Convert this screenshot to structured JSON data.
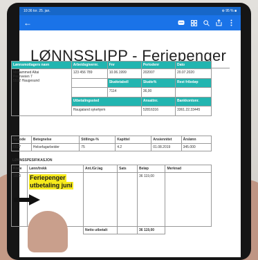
{
  "status": {
    "left": "10:36 tor. 25. jan.",
    "right": "⊕ 95 % ■"
  },
  "appbar": {
    "back": "←",
    "icons": [
      "chat-icon",
      "grid-icon",
      "search-icon",
      "share-icon",
      "more-icon"
    ]
  },
  "doc": {
    "title": "LØNNSSLIPP - Feriepenger",
    "table1": {
      "headers": [
        "Lønnsmottagers navn",
        "Arbeidsgivernr.",
        "Fnr",
        "Periodenr",
        "Dato"
      ],
      "name": "Mohammed Altai",
      "address1": "Peonveien 7",
      "address2": "5532 Haugesund",
      "arbnr": "123 456 789",
      "fnr": "10.06.1999",
      "periodenr": "202007",
      "dato": "20.07.2020",
      "row2_headers": [
        "Skattetabell",
        "Skatte%",
        "Rest fribeløp"
      ],
      "skattetabell": "7114",
      "skatteprosent": "36,00",
      "row3_headers": [
        "Utbetalingssted",
        "Ansattnr.",
        "Bankkontonr."
      ],
      "utbetalingssted": "Haugaland sykehjem",
      "ansattnr": "52816316",
      "bankkonto": "3361.22.33445"
    },
    "table2": {
      "headers": [
        "St.kode",
        "Betegnelse",
        "Stillings-%",
        "Kapittel",
        "Ansiennitet",
        "Årslønn"
      ],
      "values": [
        "6627",
        "Helsefagarbeider",
        "75",
        "4.2",
        "01.08.2019",
        "345.000"
      ]
    },
    "spec_title": "LØNNSSPESIFIKASJON",
    "table3": {
      "headers": [
        "Kode",
        "Lønn/trekk",
        "Ant./Gr.lag",
        "Sats",
        "Beløp",
        "Merknad"
      ],
      "kode": "1800",
      "line1": "Feriepenger",
      "line2": "utbetaling juni",
      "belop": "36 119,00",
      "total_label": "Netto utbetalt",
      "total_value": "36 119,00"
    }
  }
}
